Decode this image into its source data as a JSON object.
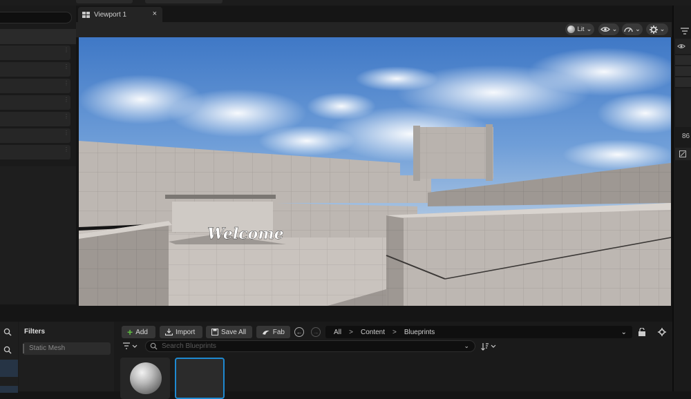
{
  "viewport": {
    "tab_label": "Viewport 1",
    "close_glyph": "×",
    "toolbar": {
      "lit_label": "Lit",
      "show_icon": "eye-icon",
      "realtime_icon": "perf-icon",
      "settings_icon": "gear-icon",
      "chevron": "⌄"
    },
    "scene_text": "Welcome"
  },
  "outliner": {
    "row_count": 7,
    "grip": "⋮"
  },
  "details_panel": {
    "value_text": "86"
  },
  "content_browser": {
    "filters_title": "Filters",
    "filters": [
      "Static Mesh"
    ],
    "buttons": {
      "add": "Add",
      "import": "Import",
      "save_all": "Save All",
      "fab": "Fab"
    },
    "path": [
      "All",
      "Content",
      "Blueprints"
    ],
    "path_separator": ">",
    "search_placeholder": "Search Blueprints",
    "assets": [
      {
        "type": "sphere-thumbnail",
        "selected": false
      },
      {
        "type": "blueprint-thumbnail",
        "selected": true
      }
    ]
  },
  "colors": {
    "accent_blue": "#1e8ad2",
    "add_green": "#5fbf42",
    "panel_bg": "#1a1a1a",
    "sky": "#5b8ed0"
  }
}
